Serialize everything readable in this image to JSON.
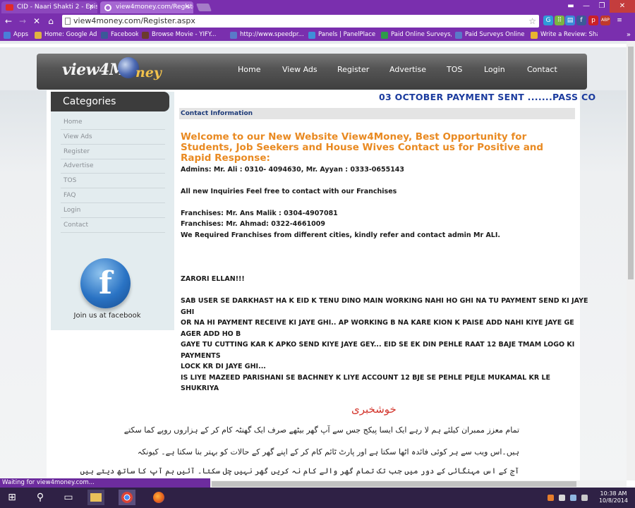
{
  "browser": {
    "tabs": [
      {
        "title": "CID - Naari Shakti 2 - Epis",
        "icon_color": "#e02a2a"
      },
      {
        "title": "view4money.com/Registe",
        "icon_color": "#f2f2f2"
      }
    ],
    "url": "view4money.com/Register.aspx",
    "extensions": [
      {
        "name": "g-icon",
        "color": "#2f9bd8",
        "glyph": "G"
      },
      {
        "name": "dots-icon",
        "color": "#7ab640",
        "glyph": "⠿"
      },
      {
        "name": "shopping-icon",
        "color": "#3b8bd9",
        "glyph": "▤"
      },
      {
        "name": "facebook-icon",
        "color": "#3b5998",
        "glyph": "f"
      },
      {
        "name": "pinterest-icon",
        "color": "#cb2027",
        "glyph": "p"
      },
      {
        "name": "adblock-icon",
        "color": "#c0392b",
        "glyph": "ABP"
      },
      {
        "name": "menu-icon",
        "color": "#7a2fae",
        "glyph": "≡"
      }
    ],
    "bookmarks": [
      {
        "label": "Apps",
        "color": "#4a7ed9"
      },
      {
        "label": "Home: Google AdSe...",
        "color": "#e0b341"
      },
      {
        "label": "Facebook",
        "color": "#3b5998"
      },
      {
        "label": "Browse Movie - YIFY...",
        "color": "#6b3b2e"
      },
      {
        "label": "http://www.speedpr...",
        "color": "#5a79c9"
      },
      {
        "label": "Panels | PanelPlace",
        "color": "#3f8fd8"
      },
      {
        "label": "Paid Online Surveys,...",
        "color": "#2e9b4a"
      },
      {
        "label": "Paid Surveys Online ...",
        "color": "#5a79c9"
      },
      {
        "label": "Write a Review: Shar...",
        "color": "#e8b32f"
      }
    ],
    "status": "Waiting for view4money.com..."
  },
  "site": {
    "logo_text": "view4M",
    "logo_text2": "ney",
    "nav": [
      "Home",
      "View Ads",
      "Register",
      "Advertise",
      "TOS",
      "Login",
      "Contact"
    ],
    "sidebar": {
      "heading": "Categories",
      "links": [
        "Home",
        "View Ads",
        "Register",
        "Advertise",
        "TOS",
        "FAQ",
        "Login",
        "Contact"
      ],
      "facebook_caption": "Join us at facebook"
    },
    "marquee": "03 OCTOBER PAYMENT SENT .......PASS CO",
    "contact_bar": "Contact Information",
    "welcome": "Welcome to our New Website View4Money, Best Opportunity for Students, Job Seekers and House Wives Contact us for Positive and Rapid Response:",
    "lines": [
      "Admins: Mr. Ali : 0310- 4094630, Mr. Ayyan : 0333-0655143",
      "All new Inquiries Feel free to contact with our Franchises",
      "Franchises: Mr. Ans Malik : 0304-4907081",
      "Franchises: Mr. Ahmad: 0322-4661009",
      "We Required Franchises from different cities, kindly refer and contact admin Mr ALI.",
      "ZARORI ELLAN!!!",
      "SAB USER SE DARKHAST HA K EID K TENU DINO MAIN WORKING NAHI HO GHI NA TU PAYMENT SEND KI JAYE",
      "GHI",
      "OR NA HI PAYMENT RECEIVE KI JAYE GHI.. AP WORKING B NA KARE KION K PAISE ADD NAHI KIYE JAYE GE",
      "AGER ADD HO B",
      "GAYE TU CUTTING KAR K APKO SEND KIYE JAYE GEY... EID SE EK DIN PEHLE RAAT 12 BAJE TMAM LOGO KI",
      "PAYMENTS",
      "LOCK KR DI JAYE GHI...",
      "IS LIYE MAZEED PARISHANI SE BACHNEY K LIYE ACCOUNT 12 BJE SE PEHLE PEJLE MUKAMAL KR LE",
      "SHUKRIYA"
    ],
    "urdu_heading": "خوشخبری",
    "urdu_lines": [
      "تمام معزز ممبران کیلئے ہم لا رہے ایک ایسا پیکج جس سے آپ گھر بیٹھے صرف ایک گھنٹہ کام کر کے ہزاروں روپے کما سکتے",
      "ہیں۔اس ویب سے ہر کوئی فائدہ اٹھا سکتا ہے اور پارٹ ٹائم کام کر کے اپنے گھر کے حالات کو بہتر بنا سکتا ہے۔ کیونکہ",
      "آج کے اس مہنگائی کے دور میں جب تک تمام گھر والے کام نہ کریں گھر نہیں چل سکتا۔ آئیں ہم آپ کا ساتھ دیتے ہیں"
    ]
  },
  "taskbar": {
    "time": "10:38 AM",
    "date": "10/8/2014"
  }
}
